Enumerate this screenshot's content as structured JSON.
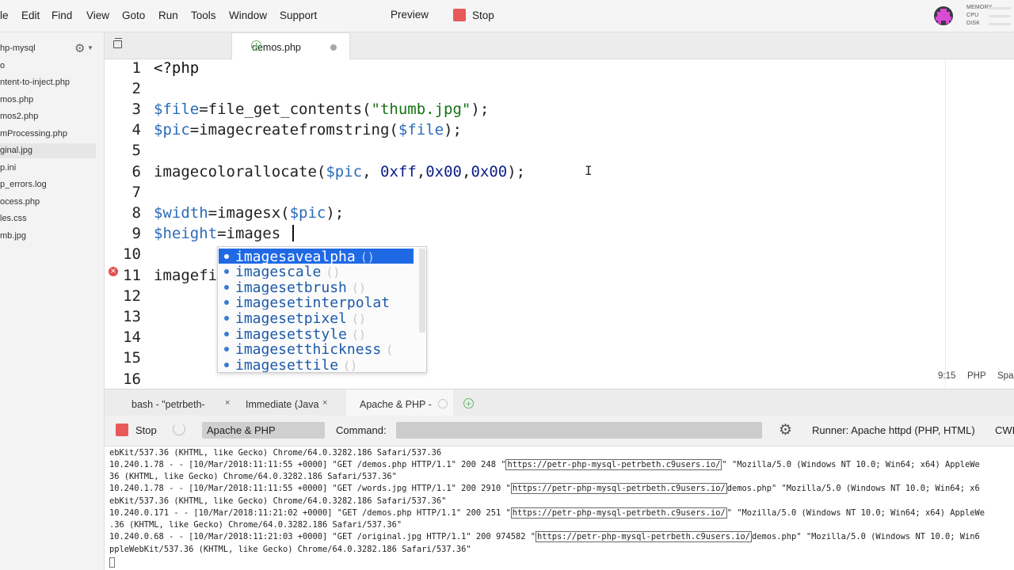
{
  "menu": {
    "items": [
      "le",
      "Edit",
      "Find",
      "View",
      "Goto",
      "Run",
      "Tools",
      "Window",
      "Support"
    ],
    "preview": "Preview",
    "stop": "Stop",
    "meters": [
      "MEMORY",
      "CPU",
      "DISK"
    ]
  },
  "filetree": {
    "items": [
      "hp-mysql",
      "o",
      "ntent-to-inject.php",
      "mos.php",
      "mos2.php",
      "mProcessing.php",
      "ginal.jpg",
      "p.ini",
      "p_errors.log",
      "ocess.php",
      "les.css",
      "mb.jpg"
    ],
    "selected_index": 6
  },
  "editor": {
    "tab_label": "demos.php",
    "line_numbers": [
      "1",
      "2",
      "3",
      "4",
      "5",
      "6",
      "7",
      "8",
      "9",
      "10",
      "11",
      "12",
      "13",
      "14",
      "15",
      "16"
    ],
    "code": {
      "l1": "<?php",
      "l3_var": "$file",
      "l3_rest": "=file_get_contents(",
      "l3_str": "\"thumb.jpg\"",
      "l3_end": ");",
      "l4_var": "$pic",
      "l4_rest": "=imagecreatefromstring(",
      "l4_arg": "$file",
      "l4_end": ");",
      "l6_fn": "imagecolorallocate(",
      "l6_arg": "$pic",
      "l6_sep": ", ",
      "l6_n1": "0xff",
      "l6_n2": "0x00",
      "l6_n3": "0x00",
      "l6_end": ");",
      "l8_var": "$width",
      "l8_rest": "=imagesx(",
      "l8_arg": "$pic",
      "l8_end": ");",
      "l9_var": "$height",
      "l9_rest": "=images",
      "l11": "imagefi"
    },
    "error_marker": "×",
    "status": {
      "position": "9:15",
      "language": "PHP",
      "indent": "Spa"
    }
  },
  "autocomplete": {
    "prefix": "images",
    "items": [
      {
        "suffix": "avealpha",
        "parens": "()"
      },
      {
        "suffix": "cale",
        "parens": "()"
      },
      {
        "suffix": "etbrush",
        "parens": "()"
      },
      {
        "suffix": "etinterpolat",
        "parens": ""
      },
      {
        "suffix": "etpixel",
        "parens": "()"
      },
      {
        "suffix": "etstyle",
        "parens": "()"
      },
      {
        "suffix": "etthickness",
        "parens": "("
      },
      {
        "suffix": "ettile",
        "parens": "()"
      }
    ],
    "selected_index": 0
  },
  "bottom_tabs": [
    {
      "label": "bash - \"petrbeth-",
      "close": "×"
    },
    {
      "label": "Immediate (Java",
      "close": "×"
    },
    {
      "label": "Apache & PHP -"
    }
  ],
  "runner": {
    "stop": "Stop",
    "name": "Apache & PHP",
    "command_label": "Command:",
    "command_value": "",
    "runner_label": "Runner: Apache httpd (PHP, HTML)",
    "cwd": "CWI"
  },
  "console": {
    "lines": [
      {
        "pre": "ebKit/537.36 (KHTML, like Gecko) Chrome/64.0.3282.186 Safari/537.36"
      },
      {
        "pre": "10.240.1.78 - - [10/Mar/2018:11:11:55 +0000] \"GET /demos.php HTTP/1.1\" 200 248 \"",
        "link": "https://petr-php-mysql-petrbeth.c9users.io/",
        "post": "\" \"Mozilla/5.0 (Windows NT 10.0; Win64; x64) AppleWe"
      },
      {
        "pre": "36 (KHTML, like Gecko) Chrome/64.0.3282.186 Safari/537.36\""
      },
      {
        "pre": "10.240.1.78 - - [10/Mar/2018:11:11:55 +0000] \"GET /words.jpg HTTP/1.1\" 200 2910 \"",
        "link": "https://petr-php-mysql-petrbeth.c9users.io/",
        "post": "demos.php\" \"Mozilla/5.0 (Windows NT 10.0; Win64; x6"
      },
      {
        "pre": "ebKit/537.36 (KHTML, like Gecko) Chrome/64.0.3282.186 Safari/537.36\""
      },
      {
        "pre": "10.240.0.171 - - [10/Mar/2018:11:21:02 +0000] \"GET /demos.php HTTP/1.1\" 200 251 \"",
        "link": "https://petr-php-mysql-petrbeth.c9users.io/",
        "post": "\" \"Mozilla/5.0 (Windows NT 10.0; Win64; x64) AppleWe"
      },
      {
        "pre": ".36 (KHTML, like Gecko) Chrome/64.0.3282.186 Safari/537.36\""
      },
      {
        "pre": "10.240.0.68 - - [10/Mar/2018:11:21:03 +0000] \"GET /original.jpg HTTP/1.1\" 200 974582 \"",
        "link": "https://petr-php-mysql-petrbeth.c9users.io/",
        "post": "demos.php\" \"Mozilla/5.0 (Windows NT 10.0; Win6"
      },
      {
        "pre": "ppleWebKit/537.36 (KHTML, like Gecko) Chrome/64.0.3282.186 Safari/537.36\""
      }
    ]
  },
  "colors": {
    "accent_blue": "#1f69e5",
    "stop_red": "#e8595a",
    "string_green": "#147314",
    "variable_blue": "#2b6bb8",
    "number_navy": "#0b1f8a",
    "add_green": "#69b969"
  },
  "icons": {
    "gear": "gear-icon",
    "add_tab": "plus-icon",
    "error": "error-icon",
    "text_cursor": "text-cursor-icon",
    "runner_settings": "settings-icon"
  }
}
